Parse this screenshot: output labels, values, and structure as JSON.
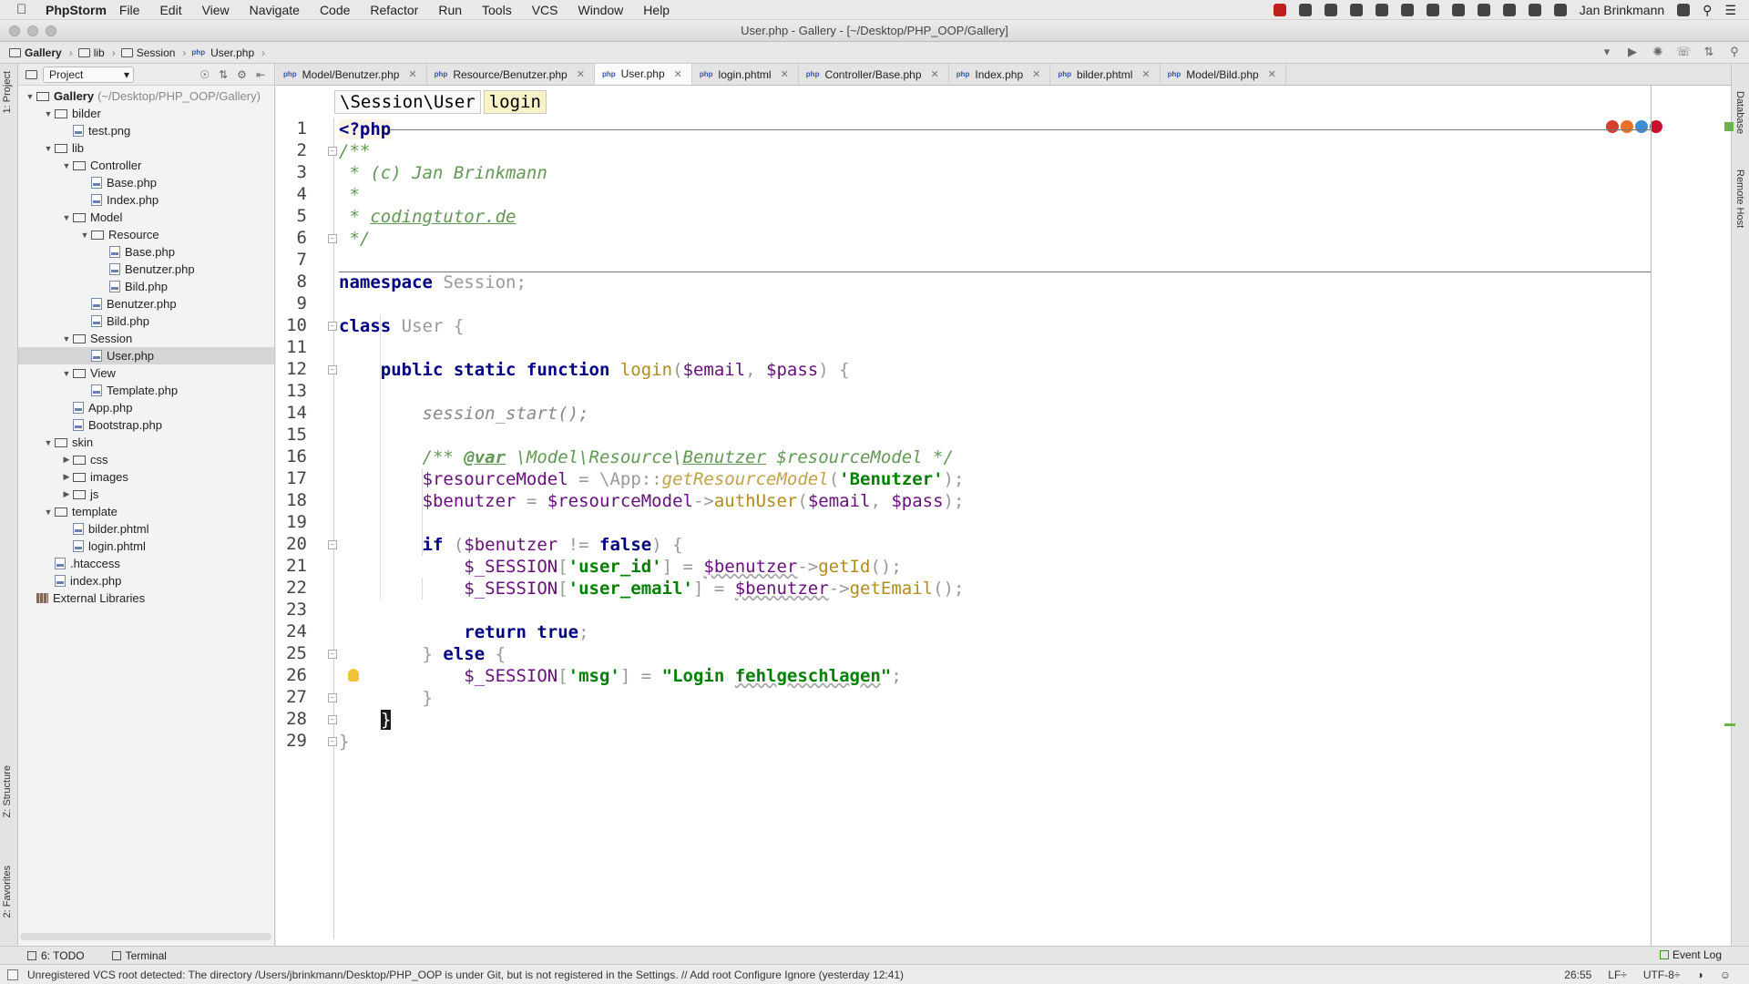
{
  "menubar": {
    "app": "PhpStorm",
    "items": [
      "File",
      "Edit",
      "View",
      "Navigate",
      "Code",
      "Refactor",
      "Run",
      "Tools",
      "VCS",
      "Window",
      "Help"
    ],
    "user": "Jan Brinkmann"
  },
  "window": {
    "title": "User.php - Gallery - [~/Desktop/PHP_OOP/Gallery]"
  },
  "navbar": {
    "crumbs": [
      "Gallery",
      "lib",
      "Session",
      "User.php"
    ]
  },
  "sidebars": {
    "left": [
      "1: Project",
      "Z: Structure",
      "2: Favorites"
    ],
    "right": [
      "Database",
      "Remote Host"
    ]
  },
  "project": {
    "view": "Project",
    "tree": [
      {
        "label": "Gallery",
        "extra": "(~/Desktop/PHP_OOP/Gallery)",
        "depth": 0,
        "type": "dir",
        "open": true,
        "bold": true
      },
      {
        "label": "bilder",
        "depth": 1,
        "type": "dir",
        "open": true
      },
      {
        "label": "test.png",
        "depth": 2,
        "type": "file"
      },
      {
        "label": "lib",
        "depth": 1,
        "type": "dir",
        "open": true
      },
      {
        "label": "Controller",
        "depth": 2,
        "type": "dir",
        "open": true
      },
      {
        "label": "Base.php",
        "depth": 3,
        "type": "file"
      },
      {
        "label": "Index.php",
        "depth": 3,
        "type": "file"
      },
      {
        "label": "Model",
        "depth": 2,
        "type": "dir",
        "open": true
      },
      {
        "label": "Resource",
        "depth": 3,
        "type": "dir",
        "open": true
      },
      {
        "label": "Base.php",
        "depth": 4,
        "type": "file"
      },
      {
        "label": "Benutzer.php",
        "depth": 4,
        "type": "file"
      },
      {
        "label": "Bild.php",
        "depth": 4,
        "type": "file"
      },
      {
        "label": "Benutzer.php",
        "depth": 3,
        "type": "file"
      },
      {
        "label": "Bild.php",
        "depth": 3,
        "type": "file"
      },
      {
        "label": "Session",
        "depth": 2,
        "type": "dir",
        "open": true
      },
      {
        "label": "User.php",
        "depth": 3,
        "type": "file",
        "selected": true
      },
      {
        "label": "View",
        "depth": 2,
        "type": "dir",
        "open": true
      },
      {
        "label": "Template.php",
        "depth": 3,
        "type": "file"
      },
      {
        "label": "App.php",
        "depth": 2,
        "type": "file"
      },
      {
        "label": "Bootstrap.php",
        "depth": 2,
        "type": "file"
      },
      {
        "label": "skin",
        "depth": 1,
        "type": "dir",
        "open": true
      },
      {
        "label": "css",
        "depth": 2,
        "type": "dir",
        "open": false
      },
      {
        "label": "images",
        "depth": 2,
        "type": "dir",
        "open": false
      },
      {
        "label": "js",
        "depth": 2,
        "type": "dir",
        "open": false
      },
      {
        "label": "template",
        "depth": 1,
        "type": "dir",
        "open": true
      },
      {
        "label": "bilder.phtml",
        "depth": 2,
        "type": "file"
      },
      {
        "label": "login.phtml",
        "depth": 2,
        "type": "file"
      },
      {
        "label": ".htaccess",
        "depth": 1,
        "type": "file"
      },
      {
        "label": "index.php",
        "depth": 1,
        "type": "file"
      },
      {
        "label": "External Libraries",
        "depth": 0,
        "type": "lib"
      }
    ]
  },
  "tabs": [
    {
      "label": "Model/Benutzer.php"
    },
    {
      "label": "Resource/Benutzer.php"
    },
    {
      "label": "User.php",
      "active": true
    },
    {
      "label": "login.phtml"
    },
    {
      "label": "Controller/Base.php"
    },
    {
      "label": "Index.php"
    },
    {
      "label": "bilder.phtml"
    },
    {
      "label": "Model/Bild.php"
    }
  ],
  "editor": {
    "breadcrumb": [
      "\\Session\\User",
      "login"
    ],
    "line_numbers": [
      "1",
      "2",
      "3",
      "4",
      "5",
      "6",
      "7",
      "8",
      "9",
      "10",
      "11",
      "12",
      "13",
      "14",
      "15",
      "16",
      "17",
      "18",
      "19",
      "20",
      "21",
      "22",
      "23",
      "24",
      "25",
      "26",
      "27",
      "28",
      "29"
    ],
    "code": {
      "l1": "<?php",
      "l2": "/**",
      "l3": " * (c) Jan Brinkmann",
      "l4": " *",
      "l5a": " * ",
      "l5b": "codingtutor.de",
      "l6": " */",
      "l8a": "namespace",
      "l8b": " Session",
      "l8c": ";",
      "l10a": "class",
      "l10b": " User {",
      "l12a": "    public static function ",
      "l12b": "login",
      "l12c": "(",
      "l12d": "$email",
      "l12e": ", ",
      "l12f": "$pass",
      "l12g": ") {",
      "l14": "        session_start();",
      "l16a": "        /** ",
      "l16b": "@var",
      "l16c": " \\Model\\Resource\\",
      "l16d": "Benutzer",
      "l16e": " $resourceModel */",
      "l17a": "        $resourceModel",
      "l17b": " = \\",
      "l17c": "App",
      "l17d": "::",
      "l17e": "getResourceModel",
      "l17f": "(",
      "l17g": "'Benutzer'",
      "l17h": ");",
      "l18a": "        $benutzer",
      "l18b": " = ",
      "l18c": "$resourceModel",
      "l18d": "->",
      "l18e": "authUser",
      "l18f": "(",
      "l18g": "$email",
      "l18h": ", ",
      "l18i": "$pass",
      "l18j": ");",
      "l20a": "        if",
      "l20b": " (",
      "l20c": "$benutzer",
      "l20d": " != ",
      "l20e": "false",
      "l20f": ") {",
      "l21a": "            $_SESSION",
      "l21b": "[",
      "l21c": "'user_id'",
      "l21d": "] = ",
      "l21e": "$benutzer",
      "l21f": "->",
      "l21g": "getId",
      "l21h": "();",
      "l22a": "            $_SESSION",
      "l22b": "[",
      "l22c": "'user_email'",
      "l22d": "] = ",
      "l22e": "$benutzer",
      "l22f": "->",
      "l22g": "getEmail",
      "l22h": "();",
      "l24a": "            return true",
      "l24b": ";",
      "l25a": "        } ",
      "l25b": "else",
      "l25c": " {",
      "l26a": "            $_SESSION",
      "l26b": "[",
      "l26c": "'msg'",
      "l26d": "] = ",
      "l26e": "\"Login ",
      "l26f": "fehlgeschlagen",
      "l26g": "\"",
      "l26h": ";",
      "l27": "        }",
      "l28": "}",
      "l29": "}"
    }
  },
  "bottom": {
    "todo": "6: TODO",
    "terminal": "Terminal",
    "eventlog": "Event Log",
    "status_message": "Unregistered VCS root detected: The directory /Users/jbrinkmann/Desktop/PHP_OOP is under Git, but is not registered in the Settings. // Add root  Configure  Ignore (yesterday 12:41)",
    "position": "26:55",
    "line_sep": "LF÷",
    "encoding": "UTF-8÷"
  }
}
